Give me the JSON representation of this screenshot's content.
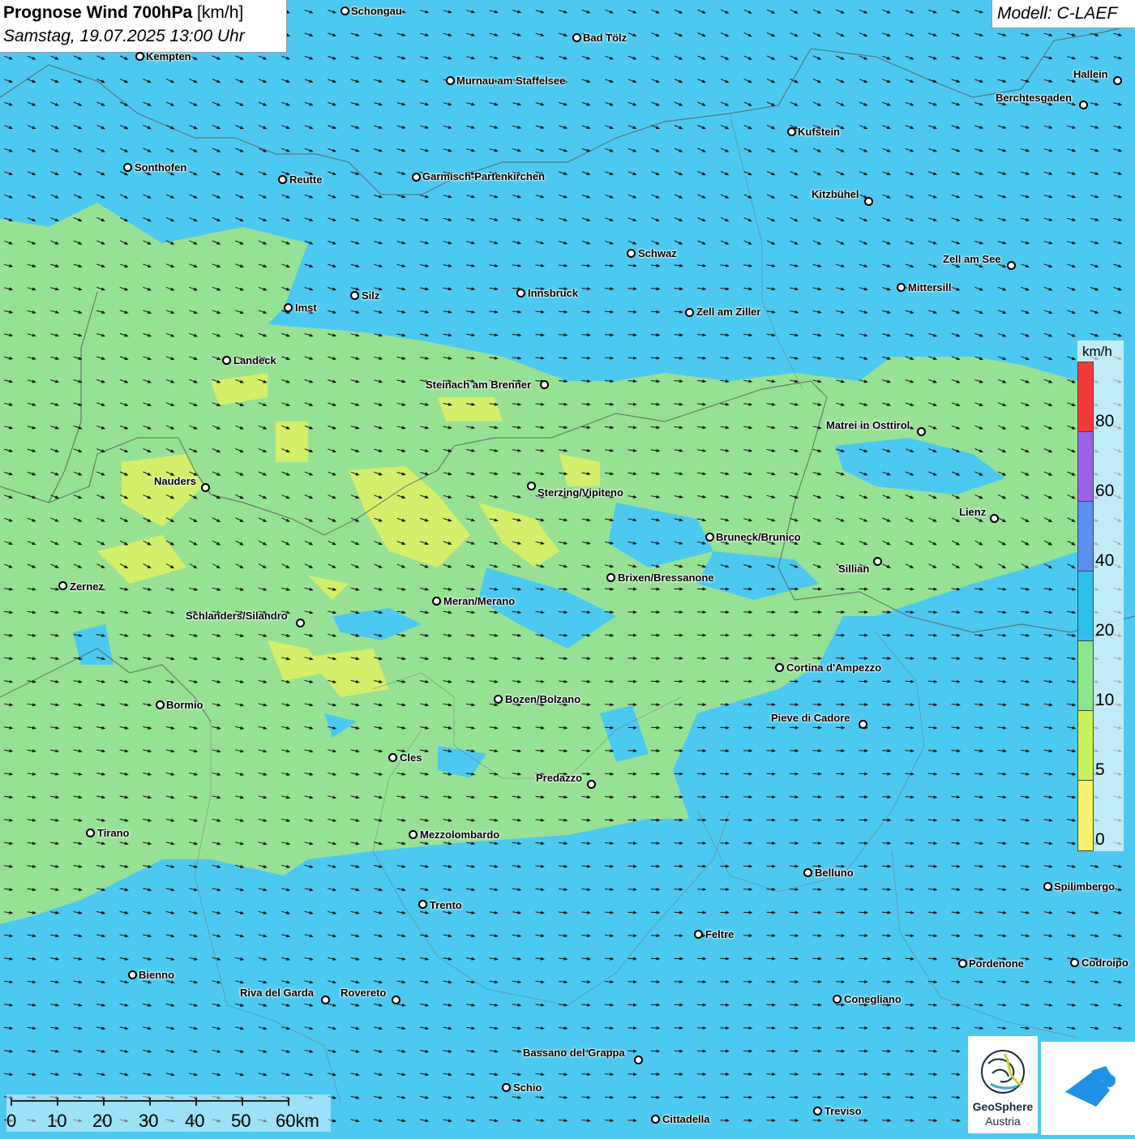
{
  "title": {
    "main_bold": "Prognose Wind 700hPa",
    "main_unit": "[km/h]",
    "date": "Samstag, 19.07.2025 13:00 Uhr"
  },
  "model": "Modell: C-LAEF",
  "legend": {
    "unit": "km/h",
    "labels": [
      "80",
      "60",
      "40",
      "20",
      "10",
      "5",
      "0"
    ],
    "colors": [
      "#f23a3a",
      "#9b63e6",
      "#5b8ff0",
      "#2fbfed",
      "#8ee68a",
      "#c8f25a",
      "#f7f26a"
    ]
  },
  "cities": [
    {
      "name": "Schongau"
    },
    {
      "name": "Bad Tölz"
    },
    {
      "name": "Kempten"
    },
    {
      "name": "Murnau am Staffelsee"
    },
    {
      "name": "Hallein"
    },
    {
      "name": "Berchtesgaden"
    },
    {
      "name": "Kufstein"
    },
    {
      "name": "Sonthofen"
    },
    {
      "name": "Reutte"
    },
    {
      "name": "Garmisch-Partenkirchen"
    },
    {
      "name": "Kitzbühel"
    },
    {
      "name": "Schwaz"
    },
    {
      "name": "Zell am See"
    },
    {
      "name": "Mittersill"
    },
    {
      "name": "Innsbruck"
    },
    {
      "name": "Silz"
    },
    {
      "name": "Imst"
    },
    {
      "name": "Zell am Ziller"
    },
    {
      "name": "Landeck"
    },
    {
      "name": "Steinach am Brenner"
    },
    {
      "name": "Matrei in Osttirol"
    },
    {
      "name": "Nauders"
    },
    {
      "name": "Sterzing/Vipiteno"
    },
    {
      "name": "Lienz"
    },
    {
      "name": "Bruneck/Brunico"
    },
    {
      "name": "Sillian"
    },
    {
      "name": "Brixen/Bressanone"
    },
    {
      "name": "Zernez"
    },
    {
      "name": "Meran/Merano"
    },
    {
      "name": "Schlanders/Silandro"
    },
    {
      "name": "Cortina d'Ampezzo"
    },
    {
      "name": "Bozen/Bolzano"
    },
    {
      "name": "Bormio"
    },
    {
      "name": "Pieve di Cadore"
    },
    {
      "name": "Cles"
    },
    {
      "name": "Predazzo"
    },
    {
      "name": "Tirano"
    },
    {
      "name": "Mezzolombardo"
    },
    {
      "name": "Belluno"
    },
    {
      "name": "Spilimbergo"
    },
    {
      "name": "Trento"
    },
    {
      "name": "Feltre"
    },
    {
      "name": "Pordenone"
    },
    {
      "name": "Codroipo"
    },
    {
      "name": "Bienno"
    },
    {
      "name": "Riva del Garda"
    },
    {
      "name": "Rovereto"
    },
    {
      "name": "Conegliano"
    },
    {
      "name": "Bassano del Grappa"
    },
    {
      "name": "Schio"
    },
    {
      "name": "Treviso"
    },
    {
      "name": "Cittadella"
    }
  ],
  "scale": {
    "labels": [
      "0",
      "10",
      "20",
      "30",
      "40",
      "50",
      "60km"
    ]
  },
  "logo": {
    "name_line1": "GeoSphere",
    "name_line2": "Austria"
  },
  "wind": {
    "dominant_direction": "from west-southwest",
    "field_colors": {
      "20-40": "#4cc9f0",
      "10-20": "#9be38f",
      "5-10": "#c9ec72",
      "0-5": "#eef07a"
    }
  }
}
